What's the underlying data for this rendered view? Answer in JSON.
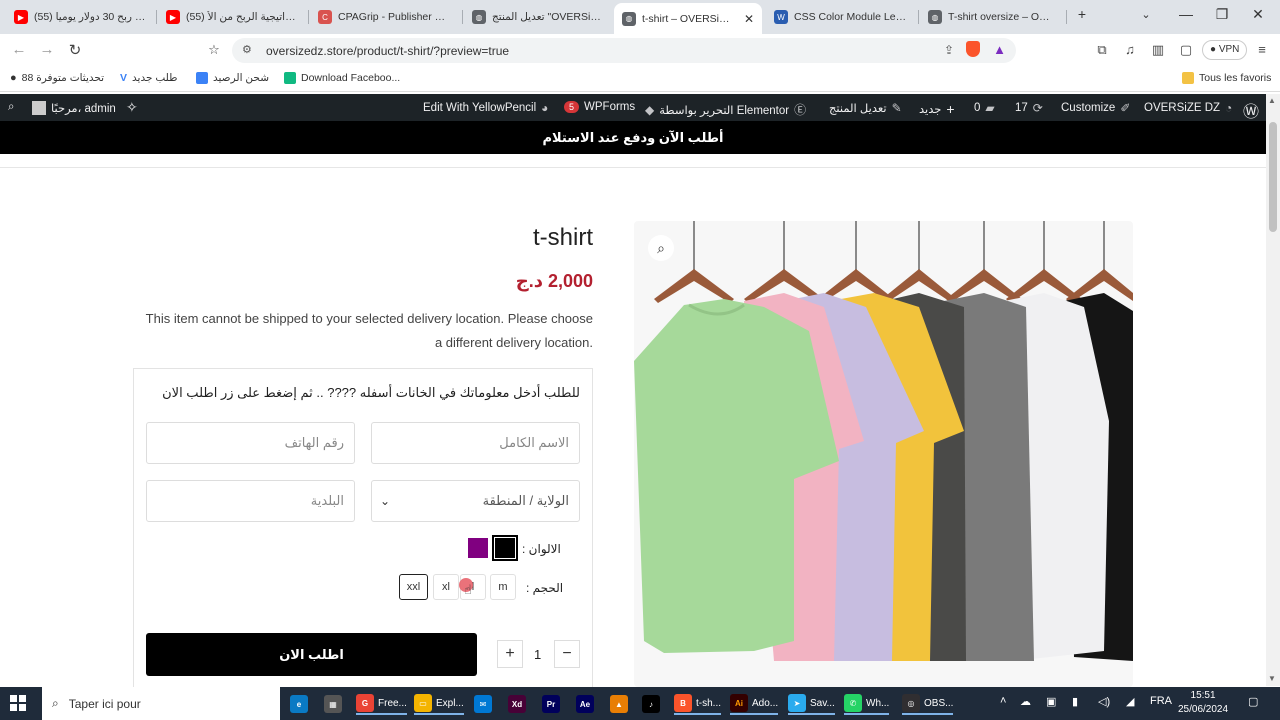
{
  "browser": {
    "tabs": [
      {
        "title": "(55) شرح ربح 30 دولار يوميا",
        "icon_color": "#ff0000",
        "active": false
      },
      {
        "title": "(55) استراتيجية الربح من الأ...",
        "icon_color": "#ff0000",
        "active": false
      },
      {
        "title": "CPAGrip - Publisher Paym...",
        "icon_color": "#d9534f",
        "active": false
      },
      {
        "title": "تعديل المنتج \"OVERSiZE DZ\"",
        "icon_color": "#5f6368",
        "active": false
      },
      {
        "title": "t-shirt – OVERSiZE DZ",
        "icon_color": "#5f6368",
        "active": true
      },
      {
        "title": "CSS Color Module Level 4",
        "icon_color": "#2a5db0",
        "active": false
      },
      {
        "title": "T-shirt oversize – OVERSi...",
        "icon_color": "#5f6368",
        "active": false
      }
    ],
    "url": "oversizedz.store/product/t-shirt/?preview=true",
    "vpn_label": "VPN",
    "bookmarks": [
      {
        "label": "88 تحديثات متوفرة",
        "color": "#333333"
      },
      {
        "label": "طلب جديد",
        "color": "#3b82f6"
      },
      {
        "label": "شحن الرصيد",
        "color": "#3b82f6"
      },
      {
        "label": "Download Faceboo...",
        "color": "#10b981"
      }
    ],
    "other_favorites": "Tous les favoris"
  },
  "adminbar": {
    "greeting": "مرحبًا، admin",
    "yellowpencil": "Edit With YellowPencil",
    "wpforms": "WPForms",
    "wpforms_badge": "5",
    "elementor": "التحرير بواسطة Elementor",
    "edit_product": "تعديل المنتج",
    "new": "جديد",
    "comments": "0",
    "updates": "17",
    "customize": "Customize",
    "site_name": "OVERSiZE DZ"
  },
  "notice": "أطلب الآن ودفع عند الاستلام",
  "product": {
    "title": "t-shirt",
    "price": "2,000 د.ج",
    "shipping_message": "This item cannot be shipped to your selected delivery location. Please choose a different delivery location."
  },
  "form": {
    "intro": "للطلب أدخل معلوماتك في الخانات أسفله ???? .. ثم إضغط على زر اطلب الان",
    "full_name_placeholder": "الاسم الكامل",
    "phone_placeholder": "رقم الهاتف",
    "state_placeholder": "الولاية / المنطقة",
    "city_placeholder": "البلدية",
    "colors_label": "الالوان :",
    "colors": [
      {
        "name": "black",
        "hex": "#000000",
        "selected": true
      },
      {
        "name": "purple",
        "hex": "#800080",
        "selected": false
      }
    ],
    "size_label": "الحجم :",
    "sizes": [
      {
        "label": "m",
        "selected": false
      },
      {
        "label": "l",
        "selected": false
      },
      {
        "label": "xl",
        "selected": false
      },
      {
        "label": "xxl",
        "selected": true
      }
    ],
    "quantity": "1",
    "order_button": "اطلب الان"
  },
  "taskbar": {
    "search_placeholder": "Taper ici pour",
    "apps": [
      {
        "label": "Free...",
        "color": "#ea4335",
        "glyph": "G"
      },
      {
        "label": "Expl...",
        "color": "#f4b400",
        "glyph": "▭"
      },
      {
        "label": "",
        "color": "#0078d4",
        "glyph": "✉"
      },
      {
        "label": "",
        "color": "#470137",
        "glyph": "Xd"
      },
      {
        "label": "",
        "color": "#00005b",
        "glyph": "Pr"
      },
      {
        "label": "",
        "color": "#00005b",
        "glyph": "Ae"
      },
      {
        "label": "",
        "color": "#e87e04",
        "glyph": "▲"
      },
      {
        "label": "",
        "color": "#000000",
        "glyph": "♪"
      },
      {
        "label": "t-sh...",
        "color": "#fb542b",
        "glyph": "B"
      },
      {
        "label": "Ado...",
        "color": "#330000",
        "glyph": "Ai"
      },
      {
        "label": "Sav...",
        "color": "#2aabee",
        "glyph": "➤"
      },
      {
        "label": "Wh...",
        "color": "#25d366",
        "glyph": "✆"
      },
      {
        "label": "OBS...",
        "color": "#302e31",
        "glyph": "◎"
      }
    ],
    "language": "FRA",
    "time": "15:51",
    "date": "25/06/2024"
  },
  "colors": {
    "admin_bar": "#1d2327",
    "price": "#b3202f",
    "notice_bg": "#000000",
    "order_button": "#000000"
  }
}
